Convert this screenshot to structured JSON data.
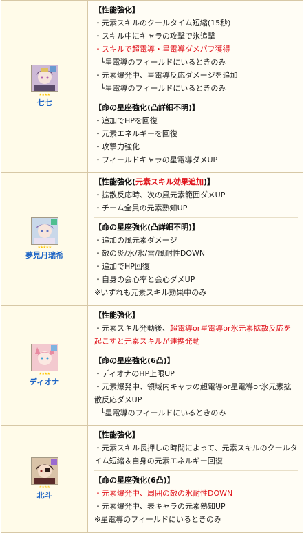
{
  "characters": [
    {
      "name": "七七",
      "stars": "★★★★",
      "perf_header": "【性能強化】",
      "perf": [
        {
          "text": "・元素スキルのクールタイム短縮(15秒)",
          "red": false
        },
        {
          "text": "・スキル中にキャラの攻撃で氷追撃",
          "red": false
        },
        {
          "text": "・スキルで超電導・星電導ダメバフ獲得",
          "red": true
        },
        {
          "text": "└星電導のフィールドにいるときのみ",
          "red": false,
          "sub": true
        },
        {
          "text": "・元素爆発中、星電導反応ダメージを追加",
          "red": false
        },
        {
          "text": "└星電導のフィールドにいるときのみ",
          "red": false,
          "sub": true
        }
      ],
      "const_header": "【命の星座強化(凸詳細不明)】",
      "const": [
        {
          "text": "・追加でHPを回復",
          "red": false
        },
        {
          "text": "・元素エネルギーを回復",
          "red": false
        },
        {
          "text": "・攻撃力強化",
          "red": false
        },
        {
          "text": "・フィールドキャラの星電導ダメUP",
          "red": false
        }
      ]
    },
    {
      "name": "夢見月瑞希",
      "stars": "★★★★★",
      "perf_header": "【性能強化(",
      "perf_header_red": "元素スキル効果追加",
      "perf_header_tail": ")】",
      "perf": [
        {
          "text": "・拡散反応時、次の風元素範囲ダメUP",
          "red": false
        },
        {
          "text": "・チーム全員の元素熟知UP",
          "red": false
        }
      ],
      "const_header": "【命の星座強化(凸詳細不明)】",
      "const": [
        {
          "text": "・追加の風元素ダメージ",
          "red": false
        },
        {
          "text": "・敵の炎/水/氷/雷/風耐性DOWN",
          "red": false
        },
        {
          "text": "・追加でHP回復",
          "red": false
        },
        {
          "text": "・自身の会心率と会心ダメUP",
          "red": false
        },
        {
          "text": "※いずれも元素スキル効果中のみ",
          "red": false
        }
      ]
    },
    {
      "name": "ディオナ",
      "stars": "★★★★",
      "perf_header": "【性能強化】",
      "perf": [
        {
          "text": "・元素スキル発動後、",
          "red": false,
          "cont": "超電導or星電導or氷元素拡散反応を起こすと元素スキルが連携発動"
        }
      ],
      "const_header": "【命の星座強化(6凸)】",
      "const": [
        {
          "text": "・ディオナのHP上限UP",
          "red": false
        },
        {
          "text": "・元素爆発中、領域内キャラの超電導or星電導or氷元素拡散反応ダメUP",
          "red": false,
          "wrap": true
        },
        {
          "text": "└星電導のフィールドにいるときのみ",
          "red": false,
          "sub": true
        }
      ]
    },
    {
      "name": "北斗",
      "stars": "★★★★",
      "perf_header": "【性能強化】",
      "perf": [
        {
          "text": "・元素スキル長押しの時間によって、元素スキルのクールタイム短縮＆自身の元素エネルギー回復",
          "red": false,
          "wrap": true
        }
      ],
      "const_header": "【命の星座強化(6凸)】",
      "const": [
        {
          "text": "・元素爆発中、周囲の敵の氷耐性DOWN",
          "red": true
        },
        {
          "text": "・元素爆発中、表キャラの元素熟知UP",
          "red": false
        },
        {
          "text": "※星電導のフィールドにいるときのみ",
          "red": false
        }
      ]
    }
  ],
  "colors": {
    "accent_red": "#e0141c",
    "name_blue": "#1d64c5",
    "border": "#d7c8a6",
    "left_bg": "#fffbe9"
  }
}
